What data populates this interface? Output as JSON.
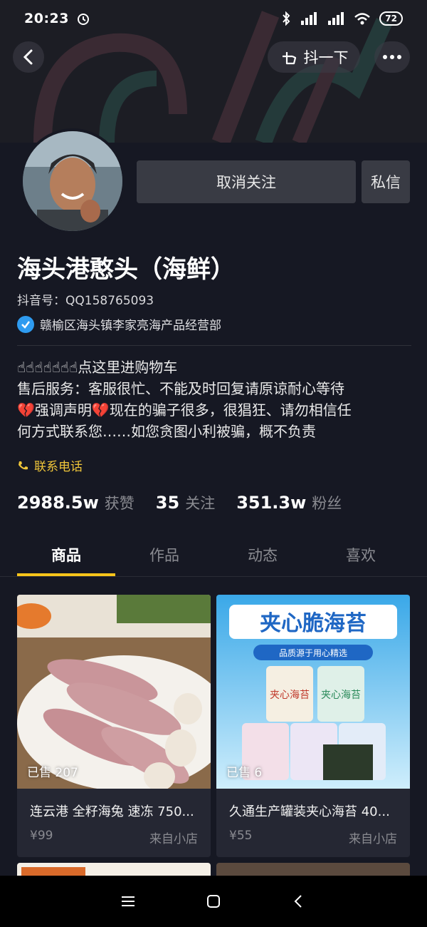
{
  "status_bar": {
    "time": "20:23",
    "battery": "72"
  },
  "header": {
    "shake_label": "抖一下"
  },
  "profile": {
    "follow_button": "取消关注",
    "message_button": "私信",
    "name": "海头港憨头（海鲜）",
    "douyin_id": "抖音号：QQ158765093",
    "verification": "赣榆区海头镇李家亮海产品经营部",
    "bio": [
      "☝☝☝☝☝☝☝点这里进购物车",
      "售后服务：客服很忙、不能及时回复请原谅耐心等待",
      "💔强调声明💔现在的骗子很多，很猖狂、请勿相信任",
      "何方式联系您……如您贪图小利被骗，概不负责"
    ],
    "phone_link": "联系电话"
  },
  "stats": [
    {
      "num": "2988.5w",
      "label": "获赞"
    },
    {
      "num": "35",
      "label": "关注"
    },
    {
      "num": "351.3w",
      "label": "粉丝"
    }
  ],
  "tabs": [
    "商品",
    "作品",
    "动态",
    "喜欢"
  ],
  "products": [
    {
      "sold": "已售 207",
      "title": "连云港 全籽海兔 速冻 750...",
      "price": "¥99",
      "from": "来自小店"
    },
    {
      "sold": "已售 6",
      "title": "久通生产罐装夹心海苔 40...",
      "price": "¥55",
      "from": "来自小店"
    }
  ],
  "product_image_text": {
    "headline": "夹心脆海苔",
    "subline": "品质源于用心精选",
    "can_label": "夹心海苔"
  },
  "colors": {
    "background": "#161823",
    "accent": "#f7c41a",
    "button": "#393b44",
    "verified": "#2e9bf0"
  }
}
